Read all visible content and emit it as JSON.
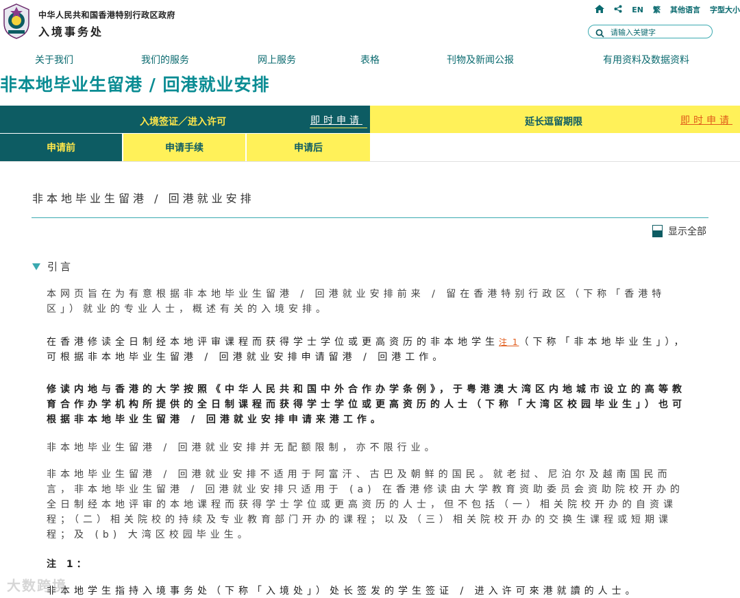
{
  "header": {
    "gov_name": "中华人民共和国香港特别行政区政府",
    "dept_name": "入境事务处",
    "top_links": [
      "EN",
      "繁",
      "其他语言",
      "字型大小"
    ],
    "search_placeholder": "请输入关键字"
  },
  "nav": [
    "关于我们",
    "我们的服务",
    "网上服务",
    "表格",
    "刊物及新闻公报",
    "有用资料及数据资料"
  ],
  "page_title": "非本地毕业生留港 / 回港就业安排",
  "tabs": {
    "visa_label": "入境签证／进入许可",
    "apply_visa": "即时申请",
    "extension_label": "延长逗留期限",
    "apply_extension": "即时申请",
    "sub_tabs": [
      "申请前",
      "申请手续",
      "申请后"
    ]
  },
  "section_title": "非本地毕业生留港 / 回港就业安排",
  "show_all": "显示全部",
  "intro": {
    "heading": "引言",
    "p1": "本网页旨在为有意根据非本地毕业生留港 / 回港就业安排前来 / 留在香港特别行政区（下称「香港特区」）就业的专业人士，概述有关的入境安排。",
    "p2_before": "在香港修读全日制经本地评审课程而获得学士学位或更高资历的非本地学生",
    "p2_note": "注 1",
    "p2_after": "（下称「非本地毕业生」），可根据非本地毕业生留港 / 回港就业安排申请留港 / 回港工作。",
    "p3": "修读内地与香港的大学按照《中华人民共和国中外合作办学条例》，于粤港澳大湾区内地城市设立的高等教育合作办学机构所提供的全日制课程而获得学士学位或更高资历的人士（下称「大湾区校园毕业生」）也可根据非本地毕业生留港 / 回港就业安排申请来港工作。",
    "p4": "非本地毕业生留港 / 回港就业安排并无配额限制，亦不限行业。",
    "p5": "非本地毕业生留港 / 回港就业安排不适用于阿富汗、古巴及朝鲜的国民。就老挝、尼泊尔及越南国民而言，非本地毕业生留港 / 回港就业安排只适用于 (a) 在香港修读由大学教育资助委员会资助院校开办的全日制经本地评审的本地课程而获得学士学位或更高资历的人士，但不包括（一）相关院校开办的自资课程；（二）相关院校的持续及专业教育部门开办的课程；以及（三）相关院校开办的交换生课程或短期课程；及 (b) 大湾区校园毕业生。"
  },
  "note": {
    "heading": "注 1：",
    "text": "非本地学生指持入境事务处（下称「入境处」）处长签发的学生签证 / 进入许可來港就讀的人士。"
  },
  "watermark": "大数跨境"
}
